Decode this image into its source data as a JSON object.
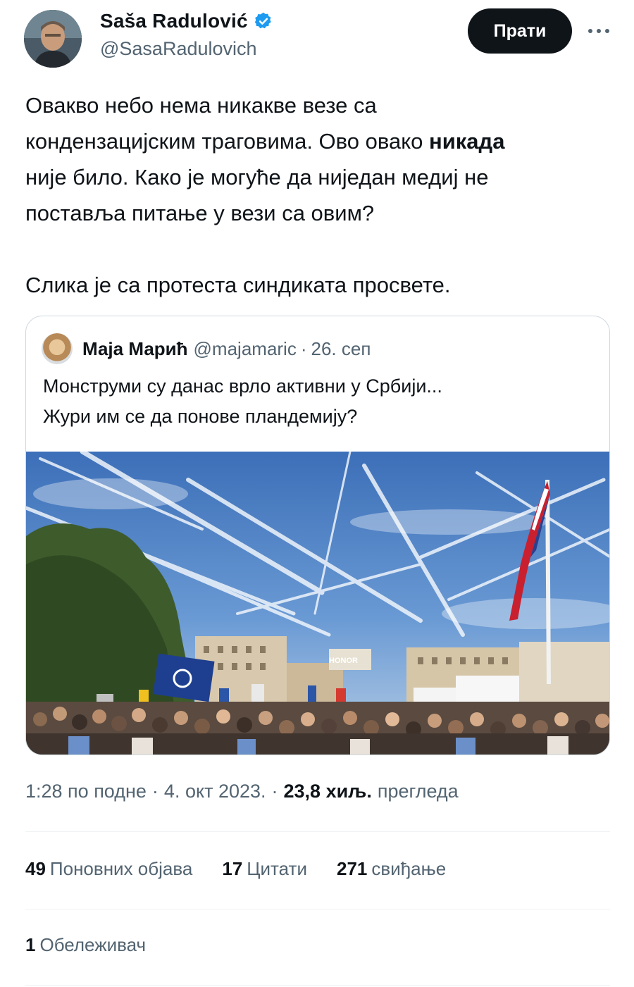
{
  "author": {
    "display_name": "Saša Radulović",
    "handle": "@SasaRadulovich",
    "verified": true
  },
  "actions": {
    "follow_label": "Прати"
  },
  "tweet": {
    "line1": "Овакво небо нема никакве везе са",
    "line2_a": "кондензацијским траговима. Ово овако ",
    "line2_bold": "никада",
    "line3": "није било. Како је могуће да ниједан медиј не",
    "line4": "поставља питање у вези са овим?",
    "line5": "Слика је са протеста синдиката просвете."
  },
  "quote": {
    "display_name": "Маја Марић",
    "handle": "@majamaric",
    "separator": "·",
    "date": "26. сеп",
    "text_line1": "Монструми су данас врло активни у Србији...",
    "text_line2": "Жури им се да понове пландемију?",
    "image_banner_text": "HONOR"
  },
  "meta": {
    "time": "1:28 по подне",
    "separator": "·",
    "date": "4. окт 2023.",
    "views_count": "23,8 хиљ.",
    "views_label": "прегледа"
  },
  "stats": {
    "reposts_count": "49",
    "reposts_label": "Поновних објава",
    "quotes_count": "17",
    "quotes_label": "Цитати",
    "likes_count": "271",
    "likes_label": "свиђање"
  },
  "bookmarks": {
    "count": "1",
    "label": "Обележивач"
  },
  "colors": {
    "text_primary": "#0f1419",
    "text_secondary": "#536471",
    "border": "#cfd9de",
    "verified_blue": "#1d9bf0",
    "button_bg": "#0f1419"
  }
}
